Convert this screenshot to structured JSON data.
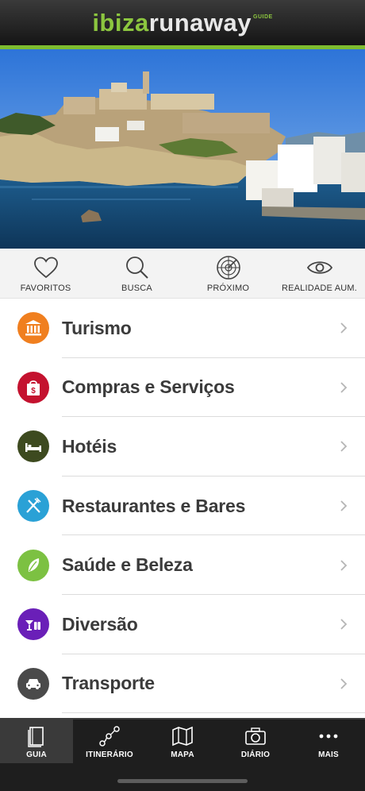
{
  "header": {
    "logo_part1": "ibiza",
    "logo_part2": "runaway",
    "logo_tag": "GUIDE",
    "accent_color": "#8cc63f"
  },
  "quick_actions": [
    {
      "label": "FAVORITOS",
      "icon": "heart-icon"
    },
    {
      "label": "BUSCA",
      "icon": "search-icon"
    },
    {
      "label": "PRÓXIMO",
      "icon": "radar-icon"
    },
    {
      "label": "REALIDADE AUM.",
      "icon": "eye-icon"
    }
  ],
  "categories": [
    {
      "label": "Turismo",
      "icon": "museum-icon",
      "color": "#f07f1f"
    },
    {
      "label": "Compras e Serviços",
      "icon": "shopping-bag-icon",
      "color": "#c4122f"
    },
    {
      "label": "Hotéis",
      "icon": "bed-icon",
      "color": "#3d4a1f"
    },
    {
      "label": "Restaurantes e Bares",
      "icon": "fork-knife-icon",
      "color": "#2aa1d6"
    },
    {
      "label": "Saúde e Beleza",
      "icon": "leaf-icon",
      "color": "#7cc142"
    },
    {
      "label": "Diversão",
      "icon": "cocktail-icon",
      "color": "#6a1fb8"
    },
    {
      "label": "Transporte",
      "icon": "car-icon",
      "color": "#4a4a4a"
    }
  ],
  "bottom_nav": [
    {
      "label": "GUIA",
      "icon": "book-icon",
      "active": true
    },
    {
      "label": "ITINERÁRIO",
      "icon": "route-icon",
      "active": false
    },
    {
      "label": "MAPA",
      "icon": "map-icon",
      "active": false
    },
    {
      "label": "DIÁRIO",
      "icon": "camera-icon",
      "active": false
    },
    {
      "label": "MAIS",
      "icon": "more-icon",
      "active": false
    }
  ]
}
